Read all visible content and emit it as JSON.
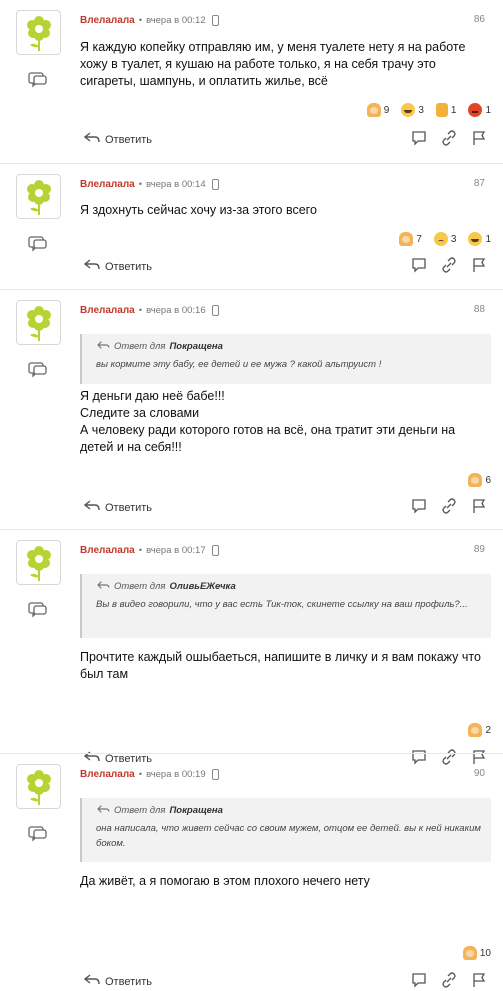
{
  "comments": [
    {
      "author": "Влелалала",
      "time": "вчера в 00:12",
      "number": "86",
      "text": "Я каждую копейку отправляю им, у меня туалете нету я на работе хожу в туалет, я кушаю на работе только, я на себя трачу это сигареты, шампунь, и оплатить жилье, всё",
      "reactions": [
        {
          "icon": "woman-facepalm-emoji",
          "count": "9"
        },
        {
          "icon": "laughing-emoji",
          "count": "3"
        },
        {
          "icon": "thumbs-down-emoji",
          "count": "1"
        },
        {
          "icon": "angry-emoji",
          "count": "1"
        }
      ],
      "reply_label": "Ответить"
    },
    {
      "author": "Влелалала",
      "time": "вчера в 00:14",
      "number": "87",
      "text": "Я здохнуть сейчас хочу из-за этого всего",
      "reactions": [
        {
          "icon": "woman-facepalm-emoji",
          "count": "7"
        },
        {
          "icon": "sad-emoji",
          "count": "3"
        },
        {
          "icon": "laughing-emoji",
          "count": "1"
        }
      ],
      "reply_label": "Ответить"
    },
    {
      "author": "Влелалала",
      "time": "вчера в 00:16",
      "number": "88",
      "quote": {
        "label": "Ответ для",
        "to": "Покращена",
        "text": "вы кормите эту бабу, ее детей и ее мужа ? какой альтруист !"
      },
      "text_lines": [
        "Я деньги даю неё бабе!!!",
        "Следите за словами",
        "А человеку ради которого готов на всё, она тратит эти деньги на детей и на себя!!!"
      ],
      "reactions": [
        {
          "icon": "woman-facepalm-emoji",
          "count": "6"
        }
      ],
      "reply_label": "Ответить"
    },
    {
      "author": "Влелалала",
      "time": "вчера в 00:17",
      "number": "89",
      "quote": {
        "label": "Ответ для",
        "to": "ОливьЕЖечка",
        "text": "Вы в видео говорили, что у вас есть Тик-ток, скинете ссылку на ваш профиль?..."
      },
      "text": "Прочтите каждый ошыбаеться, напишите в личку и я вам покажу что был там",
      "reactions": [
        {
          "icon": "woman-facepalm-emoji",
          "count": "2"
        }
      ],
      "reply_label": "Ответить"
    },
    {
      "author": "Влелалала",
      "time": "вчера в 00:19",
      "number": "90",
      "quote": {
        "label": "Ответ для",
        "to": "Покращена",
        "text": "она написала, что живет сейчас со своим мужем, отцом ее детей. вы к ней никаким боком."
      },
      "text": "Да живёт, а я помогаю в этом плохого нечего нету",
      "reactions": [
        {
          "icon": "woman-facepalm-emoji",
          "count": "10"
        }
      ],
      "reply_label": "Ответить"
    }
  ]
}
